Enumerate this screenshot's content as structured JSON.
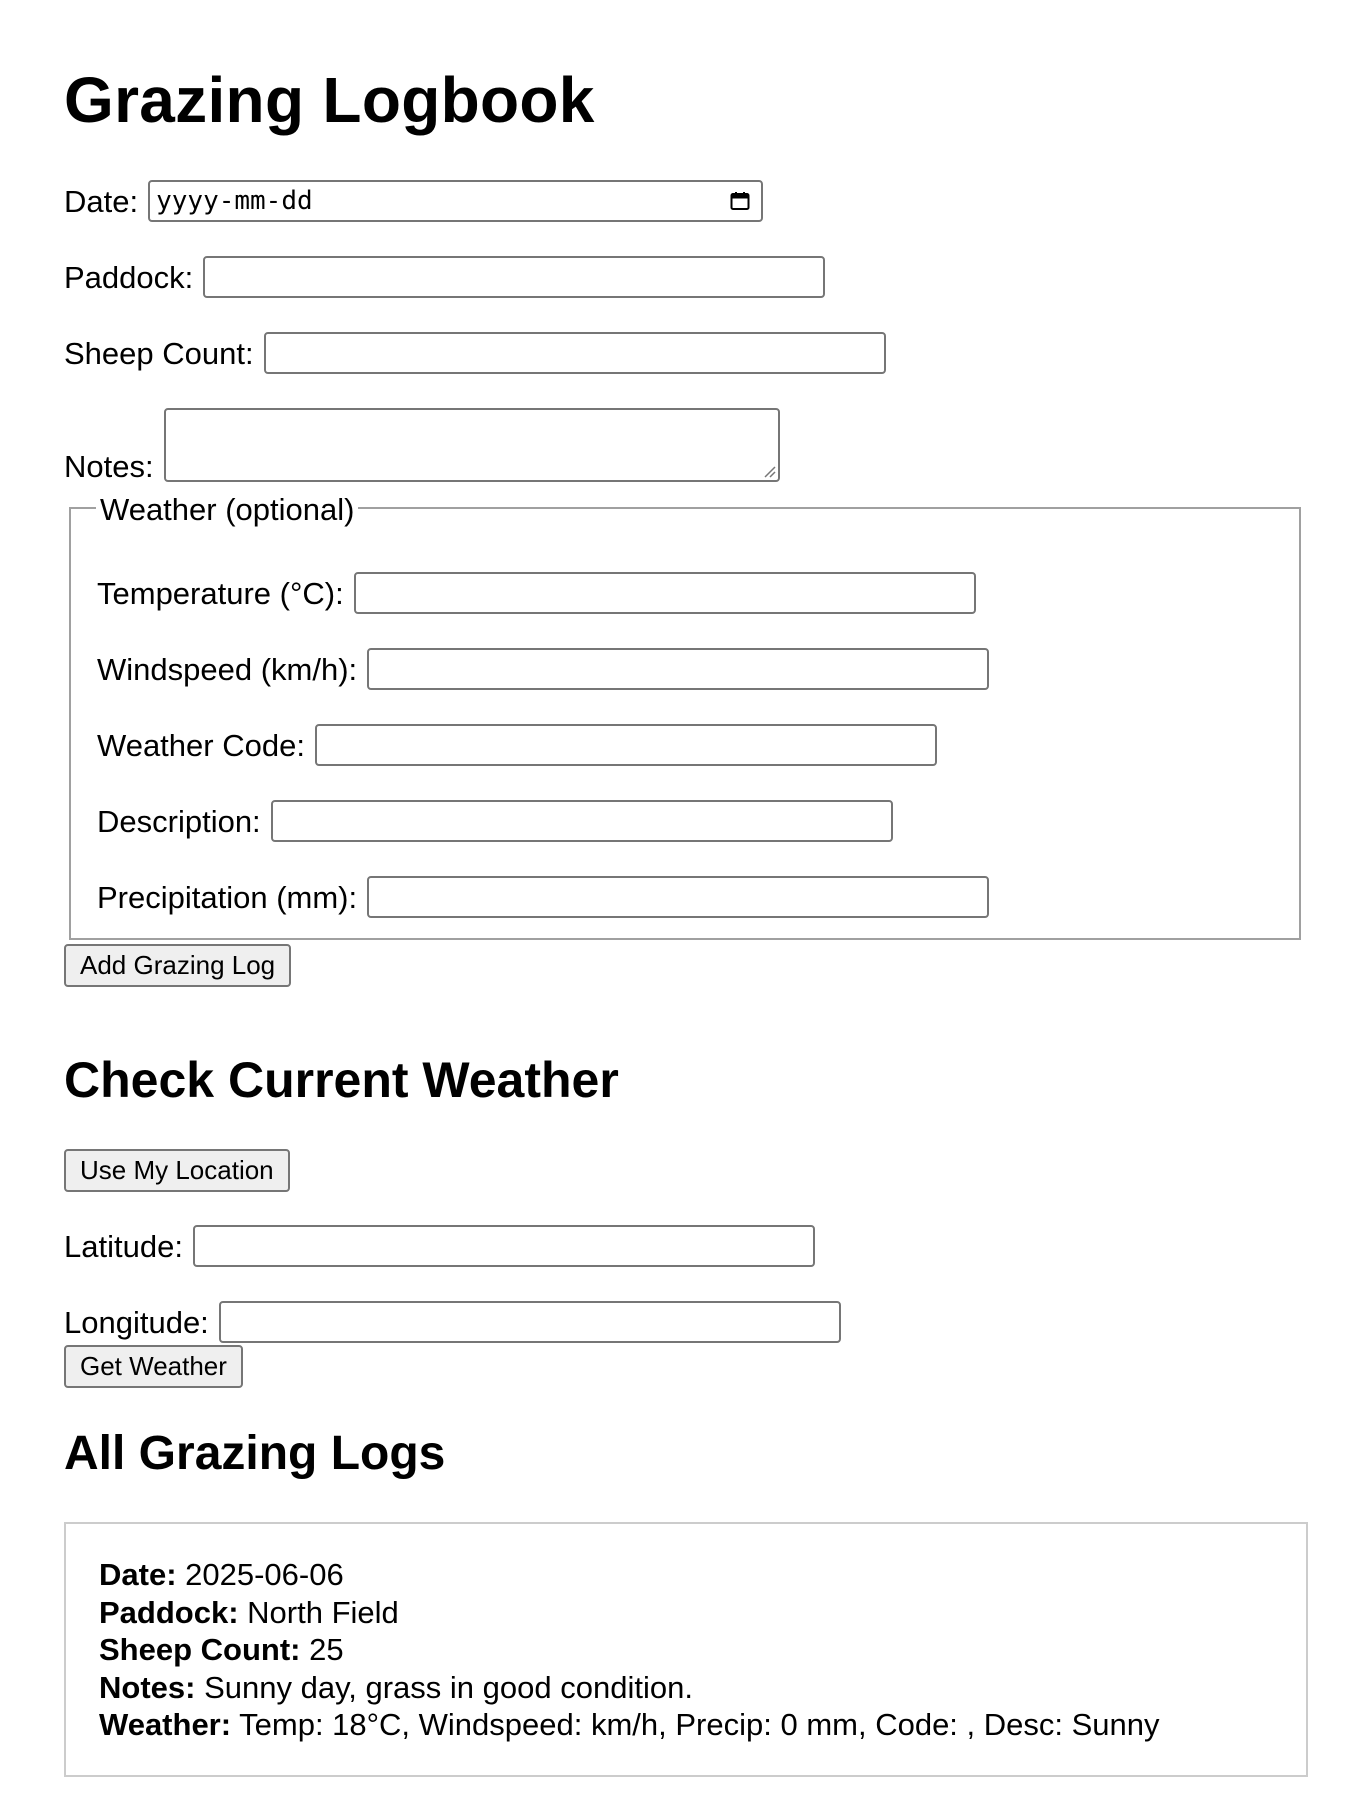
{
  "page": {
    "title": "Grazing Logbook"
  },
  "form": {
    "date": {
      "label": "Date:",
      "placeholder": "yyyy-mm-dd"
    },
    "paddock": {
      "label": "Paddock:",
      "value": ""
    },
    "sheep_count": {
      "label": "Sheep Count:",
      "value": ""
    },
    "notes": {
      "label": "Notes:",
      "value": ""
    },
    "weather": {
      "legend": "Weather (optional)",
      "temperature": {
        "label": "Temperature (°C):",
        "value": ""
      },
      "windspeed": {
        "label": "Windspeed (km/h):",
        "value": ""
      },
      "weather_code": {
        "label": "Weather Code:",
        "value": ""
      },
      "description": {
        "label": "Description:",
        "value": ""
      },
      "precipitation": {
        "label": "Precipitation (mm):",
        "value": ""
      }
    },
    "submit_label": "Add Grazing Log"
  },
  "current_weather": {
    "heading": "Check Current Weather",
    "use_location_label": "Use My Location",
    "latitude": {
      "label": "Latitude:",
      "value": ""
    },
    "longitude": {
      "label": "Longitude:",
      "value": ""
    },
    "get_weather_label": "Get Weather"
  },
  "logs": {
    "heading": "All Grazing Logs",
    "entries": [
      {
        "date_label": "Date:",
        "date": "2025-06-06",
        "paddock_label": "Paddock:",
        "paddock": "North Field",
        "sheep_count_label": "Sheep Count:",
        "sheep_count": "25",
        "notes_label": "Notes:",
        "notes": "Sunny day, grass in good condition.",
        "weather_label": "Weather:",
        "weather": "Temp: 18°C, Windspeed: km/h, Precip: 0 mm, Code: , Desc: Sunny"
      }
    ]
  },
  "icons": {
    "calendar": "calendar-icon",
    "resize_grip": "resize-grip-icon"
  }
}
